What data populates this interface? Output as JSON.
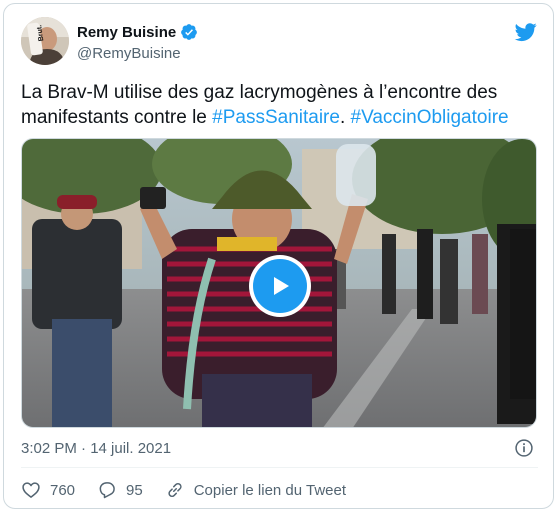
{
  "author": {
    "name": "Remy Buisine",
    "handle": "@RemyBuisine",
    "avatar_text": "Brut."
  },
  "tweet": {
    "text_before": "La Brav-M utilise des gaz lacrymogènes à l’encontre des manifestants contre le ",
    "hashtag1": "#PassSanitaire",
    "text_mid": ". ",
    "hashtag2": "#VaccinObligatoire"
  },
  "timestamp": "3:02 PM · 14 juil. 2021",
  "actions": {
    "likes": "760",
    "replies": "95",
    "copy_link": "Copier le lien du Tweet"
  },
  "colors": {
    "accent": "#1d9bf0",
    "text": "#0f1419",
    "secondary": "#536471"
  },
  "icons": {
    "verified": "verified-badge-icon",
    "brand": "twitter-bird-icon",
    "play": "play-icon",
    "info": "info-icon",
    "like": "heart-icon",
    "reply": "reply-bubble-icon",
    "link": "link-icon"
  }
}
